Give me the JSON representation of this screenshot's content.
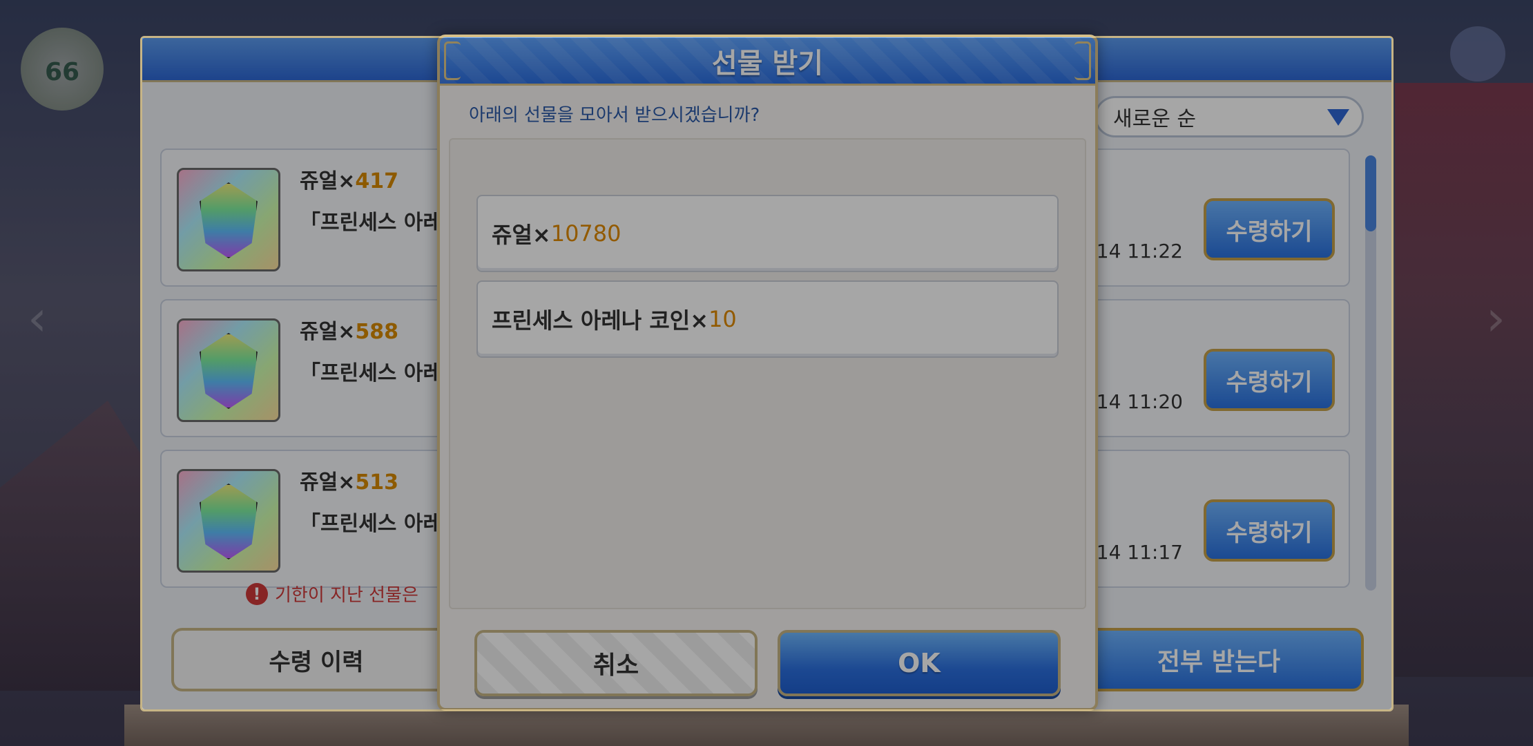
{
  "background": {
    "level": "66",
    "sort_label": "새로운 순",
    "gifts": [
      {
        "name": "쥬얼×",
        "qty": "417",
        "desc": "「프린세스 아레",
        "time": "/14 11:22",
        "claim_label": "수령하기"
      },
      {
        "name": "쥬얼×",
        "qty": "588",
        "desc": "「프린세스 아레",
        "time": "/14 11:20",
        "claim_label": "수령하기"
      },
      {
        "name": "쥬얼×",
        "qty": "513",
        "desc": "「프린세스 아레",
        "time": "/14 11:17",
        "claim_label": "수령하기"
      }
    ],
    "expired_note": "기한이 지난 선물은 ",
    "history_label": "수령 이력",
    "claim_all_label": "전부 받는다"
  },
  "modal": {
    "title": "선물 받기",
    "question": "아래의 선물을 모아서 받으시겠습니까?",
    "items": [
      {
        "name": "쥬얼×",
        "qty": "10780"
      },
      {
        "name": "프린세스 아레나 코인×",
        "qty": "10"
      }
    ],
    "cancel_label": "취소",
    "ok_label": "OK"
  },
  "colors": {
    "accent_blue": "#2d6fe0",
    "gold_border": "#d7c08a",
    "qty_orange": "#e08a00"
  }
}
